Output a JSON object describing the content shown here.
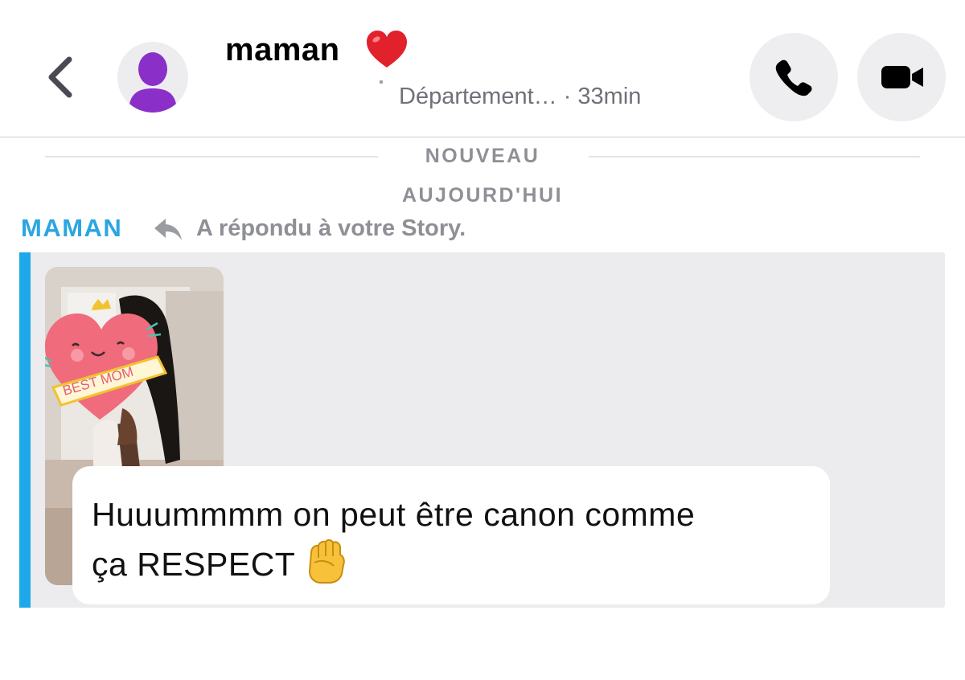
{
  "header": {
    "contact_name": "maman",
    "heart_icon": "red-heart-icon",
    "status_text": "Département…",
    "time_text": " · 33min",
    "call_icon": "phone-icon",
    "video_icon": "video-camera-icon",
    "back_icon": "chevron-left-icon"
  },
  "chat": {
    "new_divider": "NOUVEAU",
    "day_label": "AUJOURD'HUI",
    "sender_name": "MAMAN",
    "reply_label": "A répondu à votre Story.",
    "message_line1": "Huuummmm on peut être canon comme",
    "message_line2": "ça RESPECT",
    "message_emoji": "raised-fist-icon",
    "story_sticker_text": "BEST MOM"
  },
  "colors": {
    "accent_blue": "#2aa6e0",
    "bubble_bg": "#ececee",
    "muted_text": "#8e9096",
    "avatar_purple": "#8b2fc9"
  }
}
